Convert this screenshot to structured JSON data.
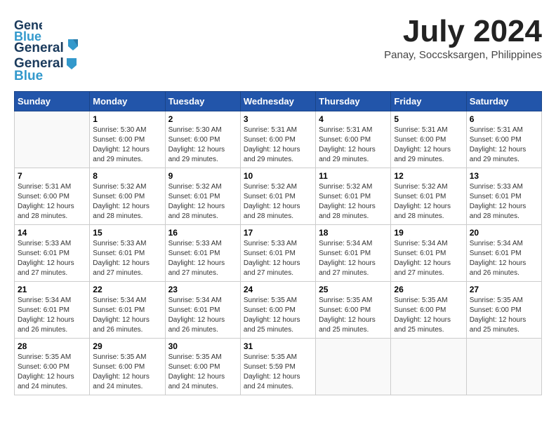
{
  "header": {
    "logo_general": "General",
    "logo_blue": "Blue",
    "title": "July 2024",
    "subtitle": "Panay, Soccsksargen, Philippines"
  },
  "weekdays": [
    "Sunday",
    "Monday",
    "Tuesday",
    "Wednesday",
    "Thursday",
    "Friday",
    "Saturday"
  ],
  "weeks": [
    [
      {
        "day": "",
        "info": ""
      },
      {
        "day": "1",
        "info": "Sunrise: 5:30 AM\nSunset: 6:00 PM\nDaylight: 12 hours\nand 29 minutes."
      },
      {
        "day": "2",
        "info": "Sunrise: 5:30 AM\nSunset: 6:00 PM\nDaylight: 12 hours\nand 29 minutes."
      },
      {
        "day": "3",
        "info": "Sunrise: 5:31 AM\nSunset: 6:00 PM\nDaylight: 12 hours\nand 29 minutes."
      },
      {
        "day": "4",
        "info": "Sunrise: 5:31 AM\nSunset: 6:00 PM\nDaylight: 12 hours\nand 29 minutes."
      },
      {
        "day": "5",
        "info": "Sunrise: 5:31 AM\nSunset: 6:00 PM\nDaylight: 12 hours\nand 29 minutes."
      },
      {
        "day": "6",
        "info": "Sunrise: 5:31 AM\nSunset: 6:00 PM\nDaylight: 12 hours\nand 29 minutes."
      }
    ],
    [
      {
        "day": "7",
        "info": "Sunrise: 5:31 AM\nSunset: 6:00 PM\nDaylight: 12 hours\nand 28 minutes."
      },
      {
        "day": "8",
        "info": "Sunrise: 5:32 AM\nSunset: 6:00 PM\nDaylight: 12 hours\nand 28 minutes."
      },
      {
        "day": "9",
        "info": "Sunrise: 5:32 AM\nSunset: 6:01 PM\nDaylight: 12 hours\nand 28 minutes."
      },
      {
        "day": "10",
        "info": "Sunrise: 5:32 AM\nSunset: 6:01 PM\nDaylight: 12 hours\nand 28 minutes."
      },
      {
        "day": "11",
        "info": "Sunrise: 5:32 AM\nSunset: 6:01 PM\nDaylight: 12 hours\nand 28 minutes."
      },
      {
        "day": "12",
        "info": "Sunrise: 5:32 AM\nSunset: 6:01 PM\nDaylight: 12 hours\nand 28 minutes."
      },
      {
        "day": "13",
        "info": "Sunrise: 5:33 AM\nSunset: 6:01 PM\nDaylight: 12 hours\nand 28 minutes."
      }
    ],
    [
      {
        "day": "14",
        "info": "Sunrise: 5:33 AM\nSunset: 6:01 PM\nDaylight: 12 hours\nand 27 minutes."
      },
      {
        "day": "15",
        "info": "Sunrise: 5:33 AM\nSunset: 6:01 PM\nDaylight: 12 hours\nand 27 minutes."
      },
      {
        "day": "16",
        "info": "Sunrise: 5:33 AM\nSunset: 6:01 PM\nDaylight: 12 hours\nand 27 minutes."
      },
      {
        "day": "17",
        "info": "Sunrise: 5:33 AM\nSunset: 6:01 PM\nDaylight: 12 hours\nand 27 minutes."
      },
      {
        "day": "18",
        "info": "Sunrise: 5:34 AM\nSunset: 6:01 PM\nDaylight: 12 hours\nand 27 minutes."
      },
      {
        "day": "19",
        "info": "Sunrise: 5:34 AM\nSunset: 6:01 PM\nDaylight: 12 hours\nand 27 minutes."
      },
      {
        "day": "20",
        "info": "Sunrise: 5:34 AM\nSunset: 6:01 PM\nDaylight: 12 hours\nand 26 minutes."
      }
    ],
    [
      {
        "day": "21",
        "info": "Sunrise: 5:34 AM\nSunset: 6:01 PM\nDaylight: 12 hours\nand 26 minutes."
      },
      {
        "day": "22",
        "info": "Sunrise: 5:34 AM\nSunset: 6:01 PM\nDaylight: 12 hours\nand 26 minutes."
      },
      {
        "day": "23",
        "info": "Sunrise: 5:34 AM\nSunset: 6:01 PM\nDaylight: 12 hours\nand 26 minutes."
      },
      {
        "day": "24",
        "info": "Sunrise: 5:35 AM\nSunset: 6:00 PM\nDaylight: 12 hours\nand 25 minutes."
      },
      {
        "day": "25",
        "info": "Sunrise: 5:35 AM\nSunset: 6:00 PM\nDaylight: 12 hours\nand 25 minutes."
      },
      {
        "day": "26",
        "info": "Sunrise: 5:35 AM\nSunset: 6:00 PM\nDaylight: 12 hours\nand 25 minutes."
      },
      {
        "day": "27",
        "info": "Sunrise: 5:35 AM\nSunset: 6:00 PM\nDaylight: 12 hours\nand 25 minutes."
      }
    ],
    [
      {
        "day": "28",
        "info": "Sunrise: 5:35 AM\nSunset: 6:00 PM\nDaylight: 12 hours\nand 24 minutes."
      },
      {
        "day": "29",
        "info": "Sunrise: 5:35 AM\nSunset: 6:00 PM\nDaylight: 12 hours\nand 24 minutes."
      },
      {
        "day": "30",
        "info": "Sunrise: 5:35 AM\nSunset: 6:00 PM\nDaylight: 12 hours\nand 24 minutes."
      },
      {
        "day": "31",
        "info": "Sunrise: 5:35 AM\nSunset: 5:59 PM\nDaylight: 12 hours\nand 24 minutes."
      },
      {
        "day": "",
        "info": ""
      },
      {
        "day": "",
        "info": ""
      },
      {
        "day": "",
        "info": ""
      }
    ]
  ]
}
